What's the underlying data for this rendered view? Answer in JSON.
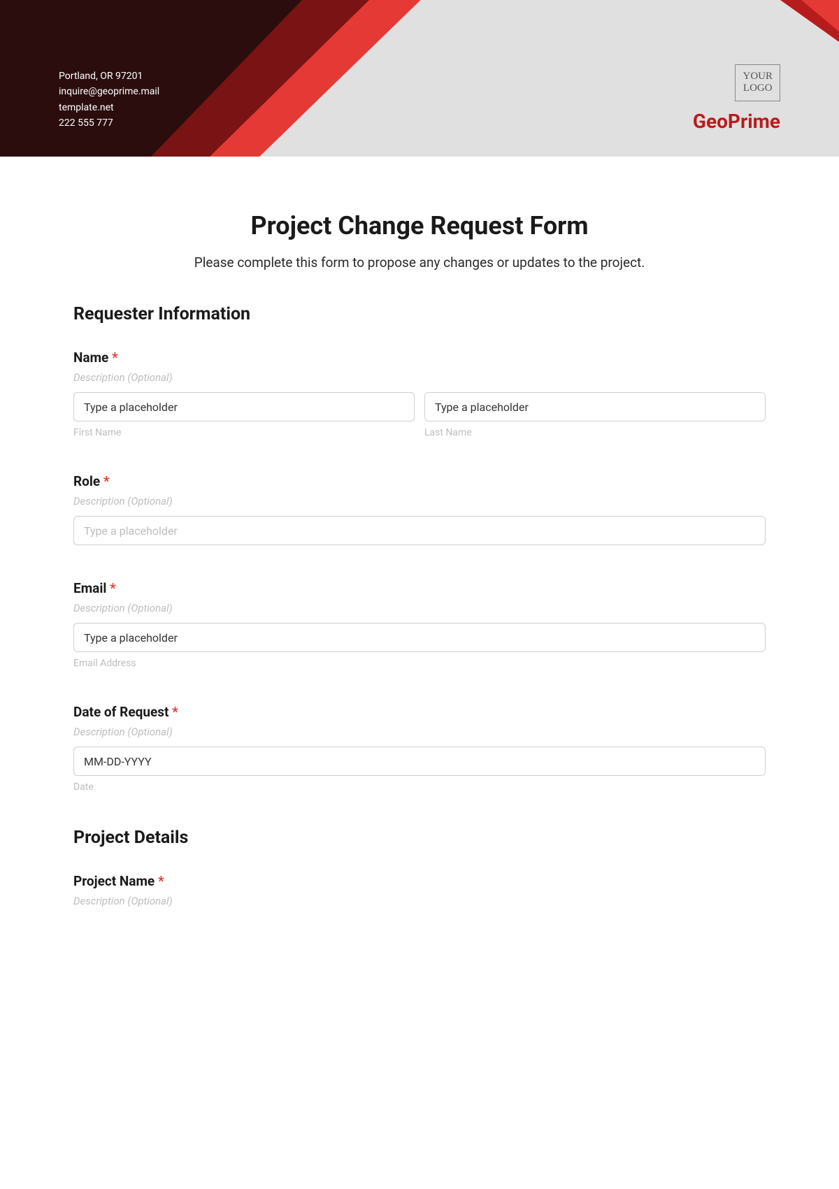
{
  "header": {
    "contact": {
      "address": "Portland, OR 97201",
      "email": "inquire@geoprime.mail",
      "website": "template.net",
      "phone": "222 555 777"
    },
    "logo_line1": "YOUR",
    "logo_line2": "LOGO",
    "brand_name": "GeoPrime"
  },
  "form": {
    "title": "Project Change Request Form",
    "instruction": "Please complete this form to propose any changes or updates to the project."
  },
  "sections": {
    "requester": {
      "heading": "Requester Information"
    },
    "project": {
      "heading": "Project Details"
    }
  },
  "fields": {
    "name": {
      "label": "Name",
      "required": "*",
      "description": "Description (Optional)",
      "first_value": "Type a placeholder",
      "last_value": "Type a placeholder",
      "first_sub": "First Name",
      "last_sub": "Last Name"
    },
    "role": {
      "label": "Role",
      "required": "*",
      "description": "Description (Optional)",
      "placeholder": "Type a placeholder"
    },
    "email": {
      "label": "Email",
      "required": "*",
      "description": "Description (Optional)",
      "value": "Type a placeholder",
      "sub": "Email Address"
    },
    "date": {
      "label": "Date of Request",
      "required": "*",
      "description": "Description (Optional)",
      "value": "MM-DD-YYYY",
      "sub": "Date"
    },
    "project_name": {
      "label": "Project Name",
      "required": "*",
      "description": "Description (Optional)"
    }
  }
}
